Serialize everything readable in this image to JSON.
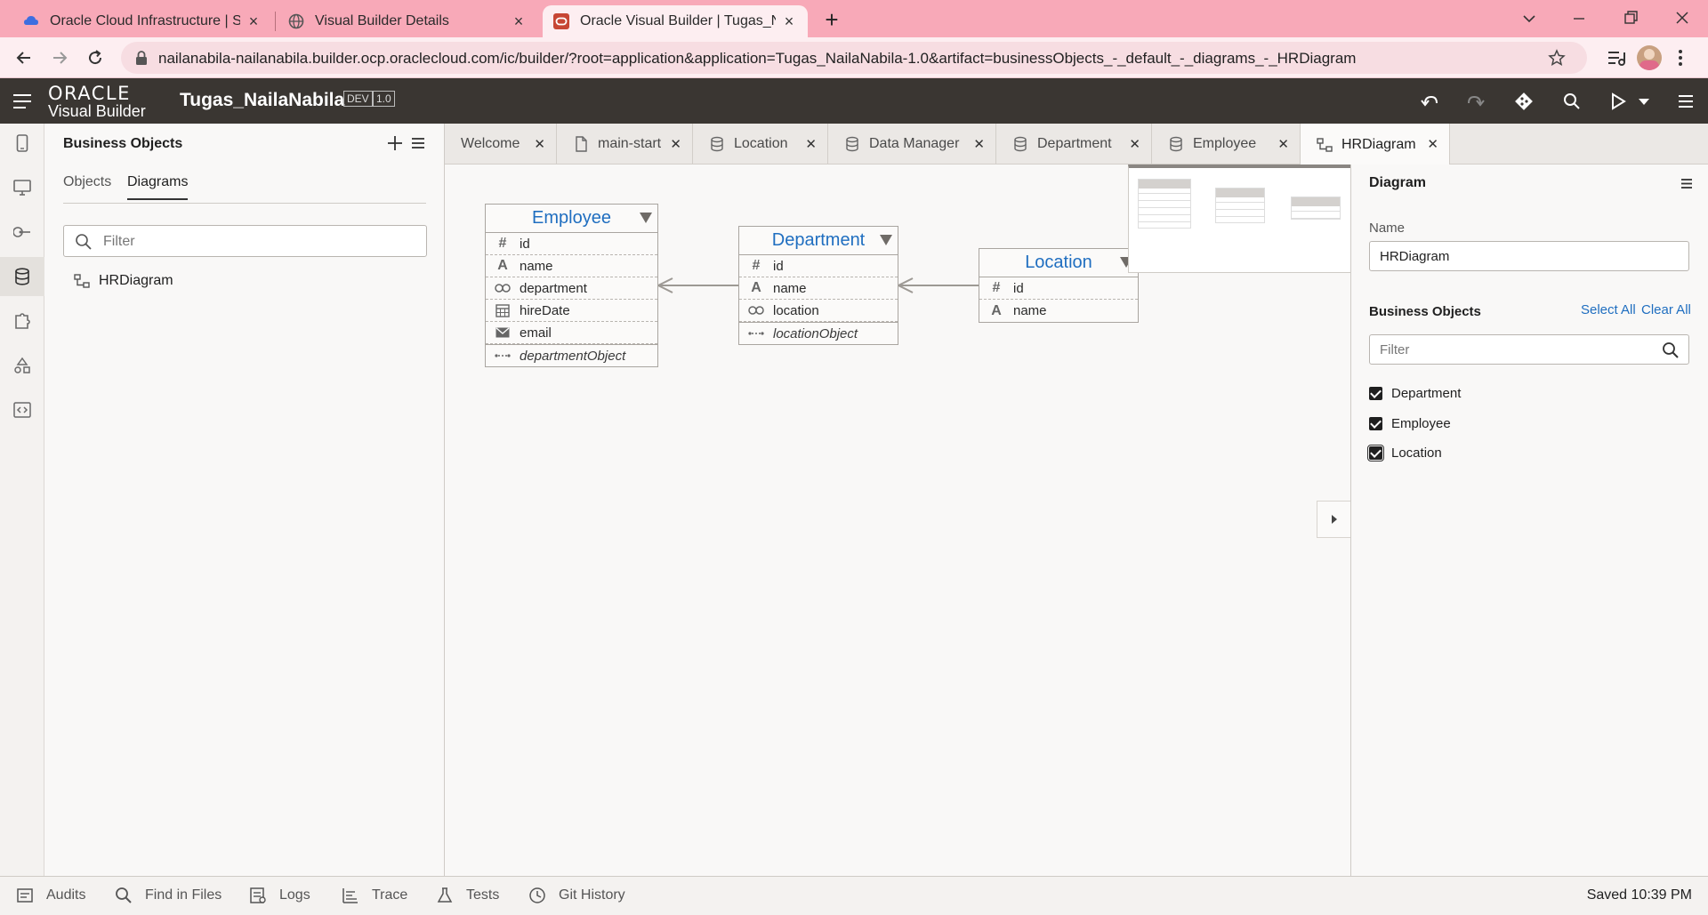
{
  "browser": {
    "tabs": [
      {
        "title": "Oracle Cloud Infrastructure | Sign",
        "icon": "cloud-icon",
        "active": false
      },
      {
        "title": "Visual Builder Details",
        "icon": "globe-icon",
        "active": false
      },
      {
        "title": "Oracle Visual Builder | Tugas_Nai",
        "icon": "oracle-icon",
        "active": true
      }
    ],
    "url": "nailanabila-nailanabila.builder.ocp.oraclecloud.com/ic/builder/?root=application&application=Tugas_NailaNabila-1.0&artifact=businessObjects_-_default_-_diagrams_-_HRDiagram"
  },
  "header": {
    "logo_top": "ORACLE",
    "logo_bottom": "Visual Builder",
    "app_name": "Tugas_NailaNabila",
    "env_badge": "DEV",
    "version_badge": "1.0"
  },
  "navigator": {
    "title": "Business Objects",
    "tabs": [
      "Objects",
      "Diagrams"
    ],
    "active_tab": "Diagrams",
    "filter_placeholder": "Filter",
    "items": [
      "HRDiagram"
    ]
  },
  "editor_tabs": [
    {
      "label": "Welcome",
      "icon": null,
      "active": false
    },
    {
      "label": "main-start",
      "icon": "page-icon",
      "active": false
    },
    {
      "label": "Location",
      "icon": "database-icon",
      "active": false
    },
    {
      "label": "Data Manager",
      "icon": "database-icon",
      "active": false
    },
    {
      "label": "Department",
      "icon": "database-icon",
      "active": false
    },
    {
      "label": "Employee",
      "icon": "database-icon",
      "active": false
    },
    {
      "label": "HRDiagram",
      "icon": "diagram-icon",
      "active": true
    }
  ],
  "diagram": {
    "entities": [
      {
        "name": "Employee",
        "fields": [
          {
            "icon": "number-icon",
            "label": "id"
          },
          {
            "icon": "text-icon",
            "label": "name"
          },
          {
            "icon": "reference-icon",
            "label": "department"
          },
          {
            "icon": "calendar-icon",
            "label": "hireDate"
          },
          {
            "icon": "email-icon",
            "label": "email"
          }
        ],
        "relation": {
          "icon": "relation-icon",
          "label": "departmentObject"
        }
      },
      {
        "name": "Department",
        "fields": [
          {
            "icon": "number-icon",
            "label": "id"
          },
          {
            "icon": "text-icon",
            "label": "name"
          },
          {
            "icon": "reference-icon",
            "label": "location"
          }
        ],
        "relation": {
          "icon": "relation-icon",
          "label": "locationObject"
        }
      },
      {
        "name": "Location",
        "fields": [
          {
            "icon": "number-icon",
            "label": "id"
          },
          {
            "icon": "text-icon",
            "label": "name"
          }
        ],
        "relation": null
      }
    ]
  },
  "properties": {
    "section_title": "Diagram",
    "name_label": "Name",
    "name_value": "HRDiagram",
    "bo_title": "Business Objects",
    "select_all": "Select All",
    "clear_all": "Clear All",
    "filter_placeholder": "Filter",
    "objects": [
      {
        "label": "Department",
        "checked": true
      },
      {
        "label": "Employee",
        "checked": true
      },
      {
        "label": "Location",
        "checked": true
      }
    ]
  },
  "bottom_bar": {
    "items": [
      {
        "label": "Audits",
        "icon": "audits-icon"
      },
      {
        "label": "Find in Files",
        "icon": "search-icon"
      },
      {
        "label": "Logs",
        "icon": "logs-icon"
      },
      {
        "label": "Trace",
        "icon": "trace-icon"
      },
      {
        "label": "Tests",
        "icon": "tests-icon"
      },
      {
        "label": "Git History",
        "icon": "history-icon"
      }
    ],
    "status": "Saved 10:39 PM"
  },
  "colors": {
    "tab_strip": "#f8a9b8",
    "header_bg": "#3a3632",
    "entity_title": "#1f6ec0",
    "link": "#1f6ec0"
  }
}
